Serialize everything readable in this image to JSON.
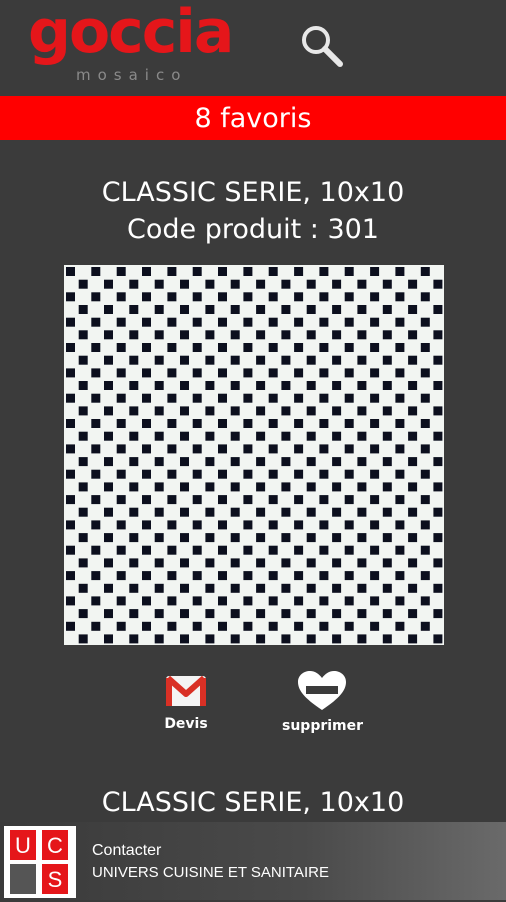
{
  "header": {
    "logo_main": "goccia",
    "logo_sub": "mosaico",
    "search_icon": "search-icon"
  },
  "favorites": {
    "label": "8 favoris"
  },
  "items": [
    {
      "title": "CLASSIC SERIE, 10x10",
      "code": "Code produit : 301",
      "actions": {
        "quote_label": "Devis",
        "remove_label": "supprimer"
      }
    },
    {
      "title": "CLASSIC SERIE, 10x10"
    }
  ],
  "footer": {
    "logo_letters": [
      "U",
      "C",
      "S"
    ],
    "line1": "Contacter",
    "line2": "UNIVERS CUISINE ET SANITAIRE"
  },
  "colors": {
    "background": "#3b3b3b",
    "accent_red": "#ff0000",
    "logo_red": "#e5161a",
    "tile_dark": "#0c0f1e",
    "tile_light": "#f2f5f2"
  }
}
